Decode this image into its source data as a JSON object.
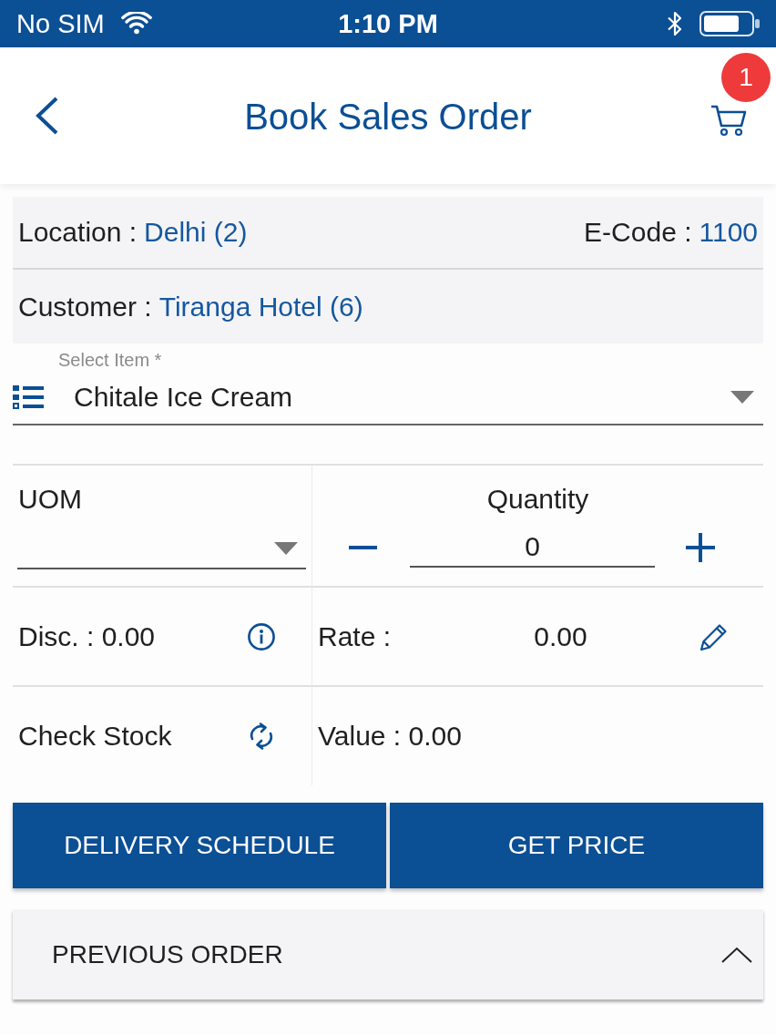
{
  "status_bar": {
    "carrier": "No SIM",
    "time": "1:10 PM"
  },
  "header": {
    "title": "Book Sales Order",
    "cart_badge": "1"
  },
  "info": [
    {
      "label": "Location :",
      "value": "Delhi (2)",
      "right": {
        "label": "E-Code :",
        "value": "1100"
      }
    },
    {
      "label": "Customer :",
      "value": "Tiranga Hotel (6)"
    }
  ],
  "select_item": {
    "label": "Select Item *",
    "value": "Chitale Ice Cream"
  },
  "uom": {
    "label": "UOM"
  },
  "quantity": {
    "label": "Quantity",
    "value": "0"
  },
  "discount": "Disc. : 0.00",
  "rate": {
    "label": "Rate :",
    "value": "0.00"
  },
  "check_stock": "Check Stock",
  "total_value": "Value : 0.00",
  "buttons": [
    "DELIVERY SCHEDULE",
    "GET PRICE"
  ],
  "previous_order": {
    "label": "PREVIOUS ORDER",
    "expanded": true
  }
}
